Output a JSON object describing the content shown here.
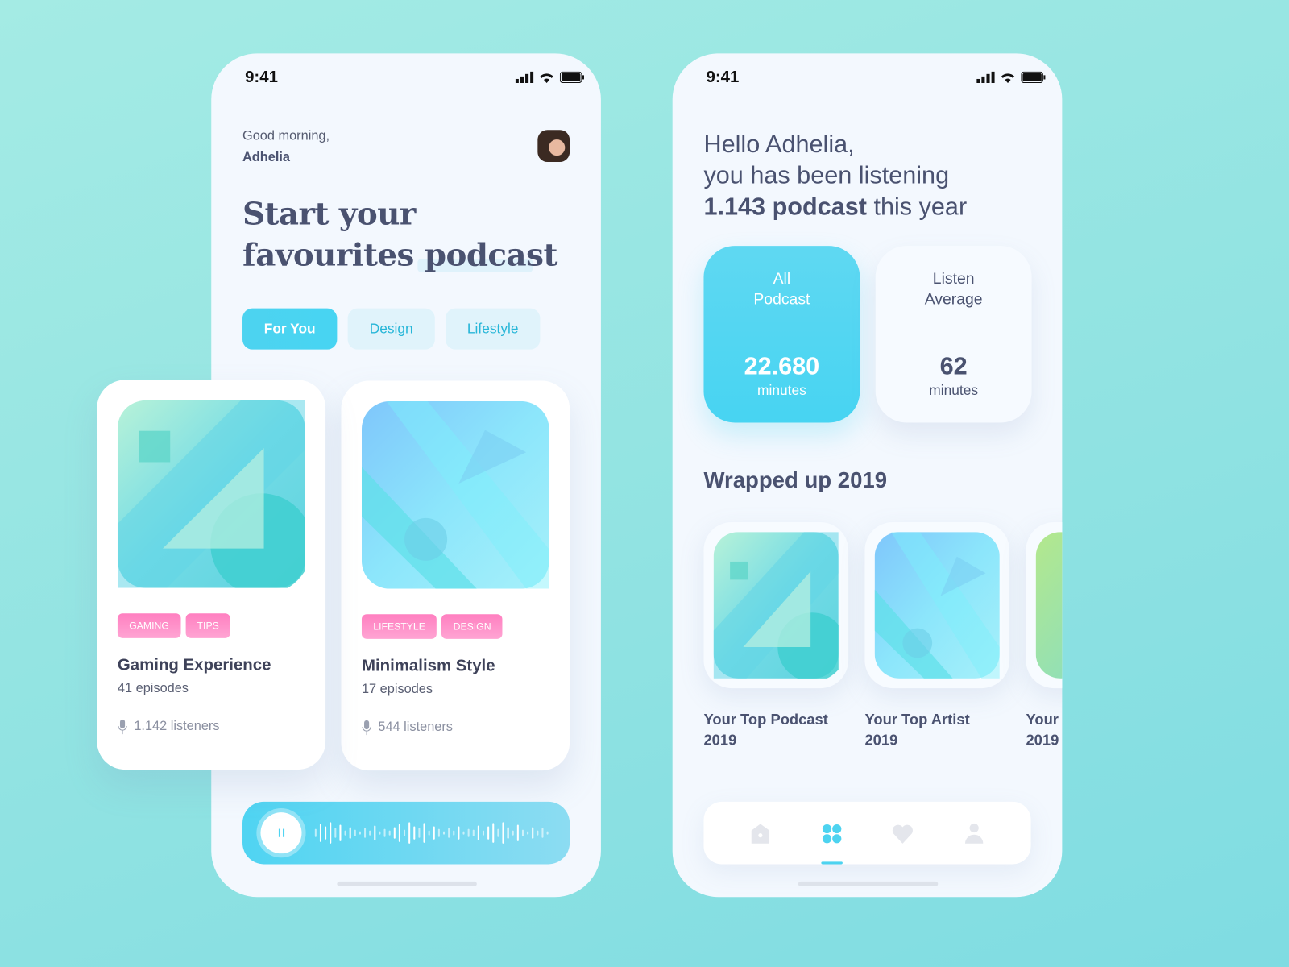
{
  "left_phone": {
    "status": {
      "time": "9:41"
    },
    "greeting": "Good morning,",
    "user_name": "Adhelia",
    "headline_line1": "Start your",
    "headline_line2": "favourites podcast",
    "tabs": [
      {
        "label": "For You",
        "active": true
      },
      {
        "label": "Design",
        "active": false
      },
      {
        "label": "Lifestyle",
        "active": false
      }
    ],
    "podcasts": [
      {
        "tags": [
          "GAMING",
          "TIPS"
        ],
        "title": "Gaming Experience",
        "episodes": "41 episodes",
        "listeners": "1.142 listeners"
      },
      {
        "tags": [
          "LIFESTYLE",
          "DESIGN"
        ],
        "title": "Minimalism Style",
        "episodes": "17 episodes",
        "listeners": "544 listeners"
      }
    ],
    "player": {
      "state": "playing",
      "control_icon": "pause-icon"
    }
  },
  "right_phone": {
    "status": {
      "time": "9:41"
    },
    "hello": "Hello Adhelia,",
    "line2": "you has been listening",
    "count_bold": "1.143 podcast",
    "count_rest": " this year",
    "stats": [
      {
        "label_line1": "All",
        "label_line2": "Podcast",
        "value": "22.680",
        "unit": "minutes"
      },
      {
        "label_line1": "Listen",
        "label_line2": "Average",
        "value": "62",
        "unit": "minutes"
      }
    ],
    "section_title": "Wrapped up 2019",
    "wrapped": [
      {
        "line1": "Your Top Podcast",
        "line2": "2019"
      },
      {
        "line1": "Your Top Artist",
        "line2": "2019"
      },
      {
        "line1": "Your",
        "line2": "2019"
      }
    ],
    "nav": [
      {
        "icon": "home-icon",
        "active": false
      },
      {
        "icon": "grid-icon",
        "active": true
      },
      {
        "icon": "heart-icon",
        "active": false
      },
      {
        "icon": "user-icon",
        "active": false
      }
    ]
  },
  "colors": {
    "accent": "#4dd3f0",
    "tag_pink": "#ff8cc6",
    "text_dark": "#4a5270",
    "background": "#93e4e2"
  }
}
